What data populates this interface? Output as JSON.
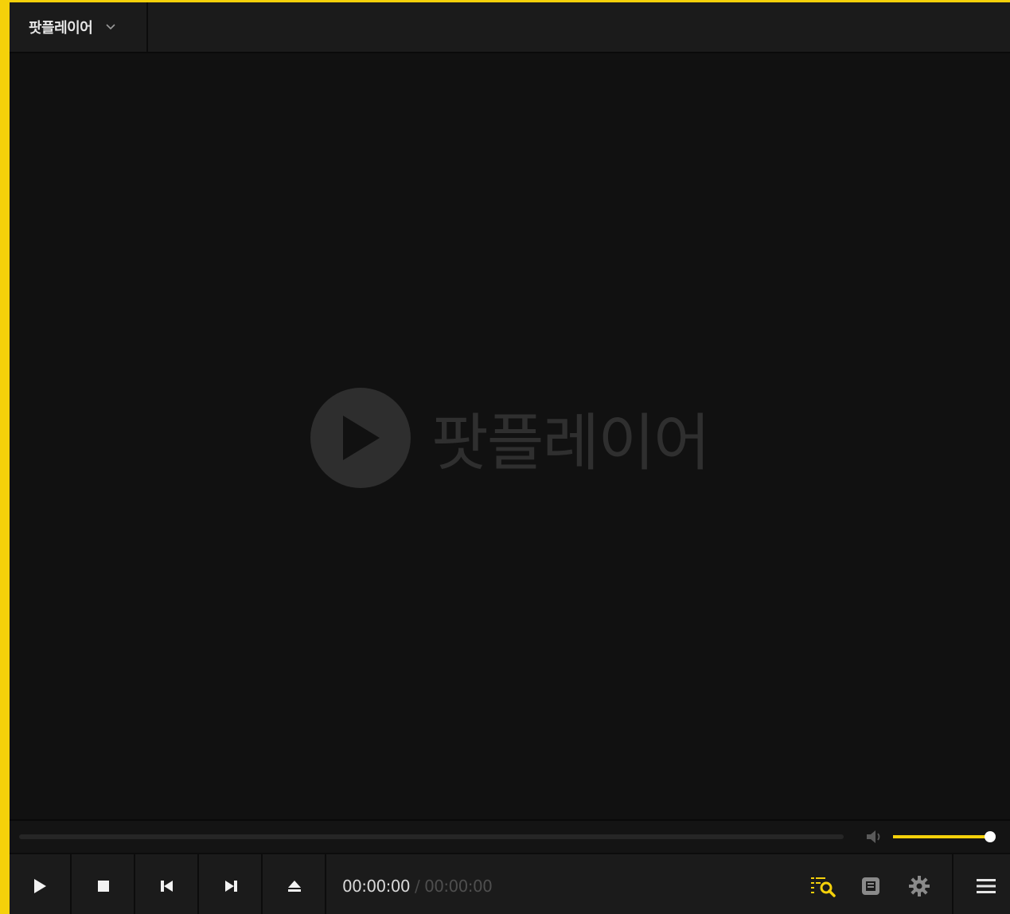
{
  "app": {
    "menu_label": "팟플레이어",
    "watermark_text": "팟플레이어"
  },
  "playback": {
    "current_time": "00:00:00",
    "separator": "/",
    "duration": "00:00:00",
    "seek_progress": 0,
    "volume": 1.0
  },
  "icons": {
    "menu_dropdown": "chevron-down-icon",
    "watermark_play": "play-circle-icon",
    "volume": "speaker-icon",
    "play": "play-icon",
    "stop": "stop-icon",
    "prev": "skip-previous-icon",
    "next": "skip-next-icon",
    "eject": "eject-icon",
    "playlist_search": "playlist-search-icon",
    "screen": "screen-icon",
    "settings": "gear-icon",
    "main_menu": "hamburger-menu-icon"
  },
  "colors": {
    "accent": "#f5d10a",
    "background": "#111111",
    "panel": "#1b1b1b"
  }
}
